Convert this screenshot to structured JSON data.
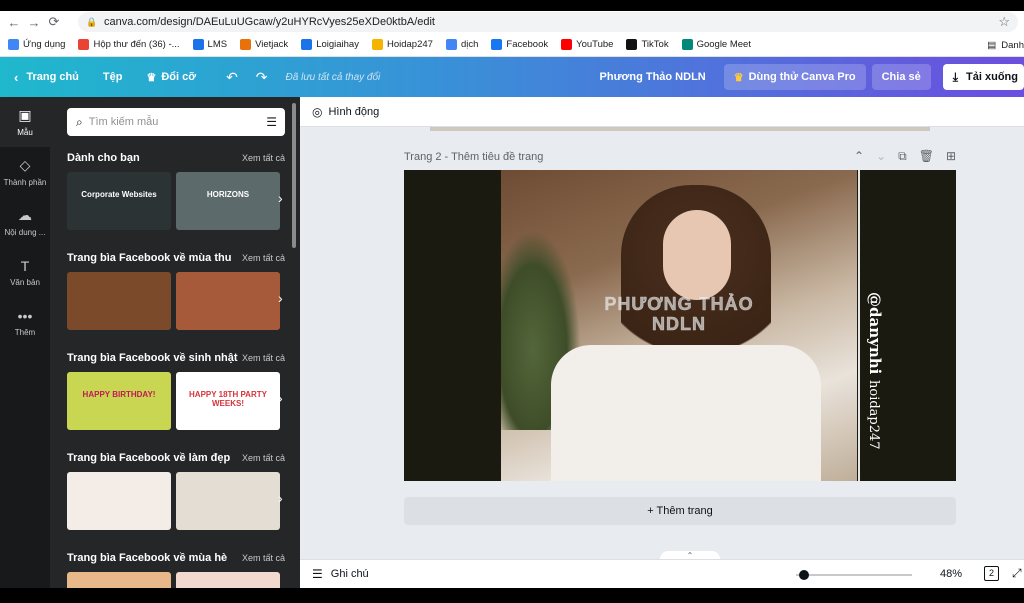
{
  "browser": {
    "url": "canva.com/design/DAEuLuUGcaw/y2uHYRcVyes25eXDe0ktbA/edit"
  },
  "bookmarks": [
    {
      "label": "Ứng dụng",
      "color": "#4285f4"
    },
    {
      "label": "Hộp thư đến (36) -...",
      "color": "#ea4335"
    },
    {
      "label": "LMS",
      "color": "#1a73e8"
    },
    {
      "label": "Vietjack",
      "color": "#e8710a"
    },
    {
      "label": "Loigiaihay",
      "color": "#1a73e8"
    },
    {
      "label": "Hoidap247",
      "color": "#f4b400"
    },
    {
      "label": "dịch",
      "color": "#4285f4"
    },
    {
      "label": "Facebook",
      "color": "#1877f2"
    },
    {
      "label": "YouTube",
      "color": "#ff0000"
    },
    {
      "label": "TikTok",
      "color": "#111111"
    },
    {
      "label": "Google Meet",
      "color": "#00897b"
    }
  ],
  "bookmarks_right": "Danh",
  "header": {
    "home": "Trang chủ",
    "file": "Tệp",
    "resize": "Đổi cỡ",
    "saved_status": "Đã lưu tất cả thay đổi",
    "design_name": "Phương Thảo NDLN",
    "try_pro": "Dùng thử Canva Pro",
    "share": "Chia sẻ",
    "download": "Tải xuống"
  },
  "rail": [
    {
      "label": "Mẫu",
      "icon": "layout-icon"
    },
    {
      "label": "Thành phần",
      "icon": "elements-icon"
    },
    {
      "label": "Nội dung ...",
      "icon": "upload-icon"
    },
    {
      "label": "Văn bản",
      "icon": "text-icon"
    },
    {
      "label": "Thêm",
      "icon": "more-icon"
    }
  ],
  "panel": {
    "search_placeholder": "Tìm kiếm mẫu",
    "see_all": "Xem tất cả",
    "sections": [
      {
        "title": "Dành cho bạn",
        "thumbs": [
          {
            "text": "Corporate Websites",
            "color": "#2b3335"
          },
          {
            "text": "HORIZONS",
            "color": "#5d6a6c"
          }
        ]
      },
      {
        "title": "Trang bìa Facebook về mùa thu",
        "thumbs": [
          {
            "text": "",
            "color": "#7a4a2a"
          },
          {
            "text": "",
            "color": "#a65a3a"
          }
        ]
      },
      {
        "title": "Trang bìa Facebook về sinh nhật",
        "thumbs": [
          {
            "text": "HAPPY BIRTHDAY!",
            "color": "#c9d652"
          },
          {
            "text": "HAPPY 18TH PARTY WEEKS!",
            "color": "#ffffff"
          }
        ]
      },
      {
        "title": "Trang bìa Facebook về làm đẹp",
        "thumbs": [
          {
            "text": "",
            "color": "#f4ece6"
          },
          {
            "text": "",
            "color": "#e3ddd3"
          }
        ]
      },
      {
        "title": "Trang bìa Facebook về mùa hè",
        "thumbs": [
          {
            "text": "",
            "color": "#e8b88a"
          },
          {
            "text": "",
            "color": "#f1d9d0"
          }
        ]
      }
    ]
  },
  "canvas": {
    "toolbar_label": "Hình động",
    "page_label": "Trang 2 - Thêm tiêu đề trang",
    "photo_title_1": "PHƯƠNG THẢO",
    "photo_title_2": "NDLN",
    "vertical_1": "@danynhi",
    "vertical_2": "hoidap247",
    "add_page": "+ Thêm trang",
    "notes": "Ghi chú",
    "zoom": "48%",
    "page_count": "2"
  }
}
